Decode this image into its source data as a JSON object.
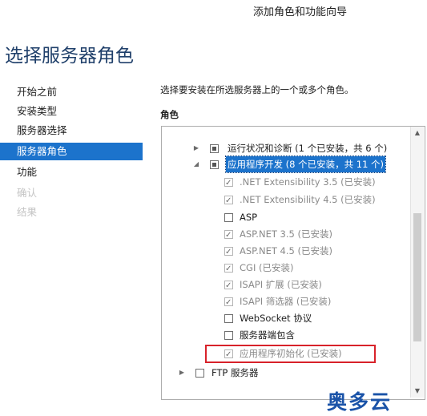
{
  "window": {
    "title": "添加角色和功能向导"
  },
  "page": {
    "heading": "选择服务器角色"
  },
  "nav": {
    "items": [
      {
        "label": "开始之前",
        "state": "normal"
      },
      {
        "label": "安装类型",
        "state": "normal"
      },
      {
        "label": "服务器选择",
        "state": "normal"
      },
      {
        "label": "服务器角色",
        "state": "active"
      },
      {
        "label": "功能",
        "state": "normal"
      },
      {
        "label": "确认",
        "state": "disabled"
      },
      {
        "label": "结果",
        "state": "disabled"
      }
    ]
  },
  "content": {
    "instruction": "选择要安装在所选服务器上的一个或多个角色。",
    "roles_label": "角色"
  },
  "roles_tree": [
    {
      "label": "运行状况和诊断 (1 个已安装，共 6 个)",
      "checkbox": "partial",
      "expander": "collapsed",
      "level": 1,
      "highlight": false,
      "disabled": false
    },
    {
      "label": "应用程序开发 (8 个已安装，共 11 个)",
      "checkbox": "partial",
      "expander": "expanded",
      "level": 1,
      "highlight": true,
      "disabled": false
    },
    {
      "label": ".NET Extensibility 3.5 (已安装)",
      "checkbox": "checked",
      "level": 2,
      "highlight": false,
      "disabled": true
    },
    {
      "label": ".NET Extensibility 4.5 (已安装)",
      "checkbox": "checked",
      "level": 2,
      "highlight": false,
      "disabled": true
    },
    {
      "label": "ASP",
      "checkbox": "unchecked",
      "level": 2,
      "highlight": false,
      "disabled": false
    },
    {
      "label": "ASP.NET 3.5 (已安装)",
      "checkbox": "checked",
      "level": 2,
      "highlight": false,
      "disabled": true
    },
    {
      "label": "ASP.NET 4.5 (已安装)",
      "checkbox": "checked",
      "level": 2,
      "highlight": false,
      "disabled": true
    },
    {
      "label": "CGI (已安装)",
      "checkbox": "checked",
      "level": 2,
      "highlight": false,
      "disabled": true
    },
    {
      "label": "ISAPI 扩展 (已安装)",
      "checkbox": "checked",
      "level": 2,
      "highlight": false,
      "disabled": true
    },
    {
      "label": "ISAPI 筛选器 (已安装)",
      "checkbox": "checked",
      "level": 2,
      "highlight": false,
      "disabled": true
    },
    {
      "label": "WebSocket 协议",
      "checkbox": "unchecked",
      "level": 2,
      "highlight": false,
      "disabled": false
    },
    {
      "label": "服务器端包含",
      "checkbox": "unchecked",
      "level": 2,
      "highlight": false,
      "disabled": false
    },
    {
      "label": "应用程序初始化 (已安装)",
      "checkbox": "checked",
      "level": 2,
      "highlight": false,
      "disabled": true
    },
    {
      "label": "FTP 服务器",
      "checkbox": "unchecked",
      "expander": "collapsed",
      "level": 0,
      "highlight": false,
      "disabled": false
    }
  ],
  "watermark": "奥多云",
  "colors": {
    "accent": "#1c73cc",
    "heading": "#1f3f6a",
    "annotation_box": "#d8222a",
    "watermark": "#1a53a8"
  },
  "icons": {
    "expand": "triangle-right-icon",
    "collapse": "triangle-down-icon",
    "scroll_up": "scroll-up-arrow-icon",
    "scroll_down": "scroll-down-arrow-icon"
  }
}
